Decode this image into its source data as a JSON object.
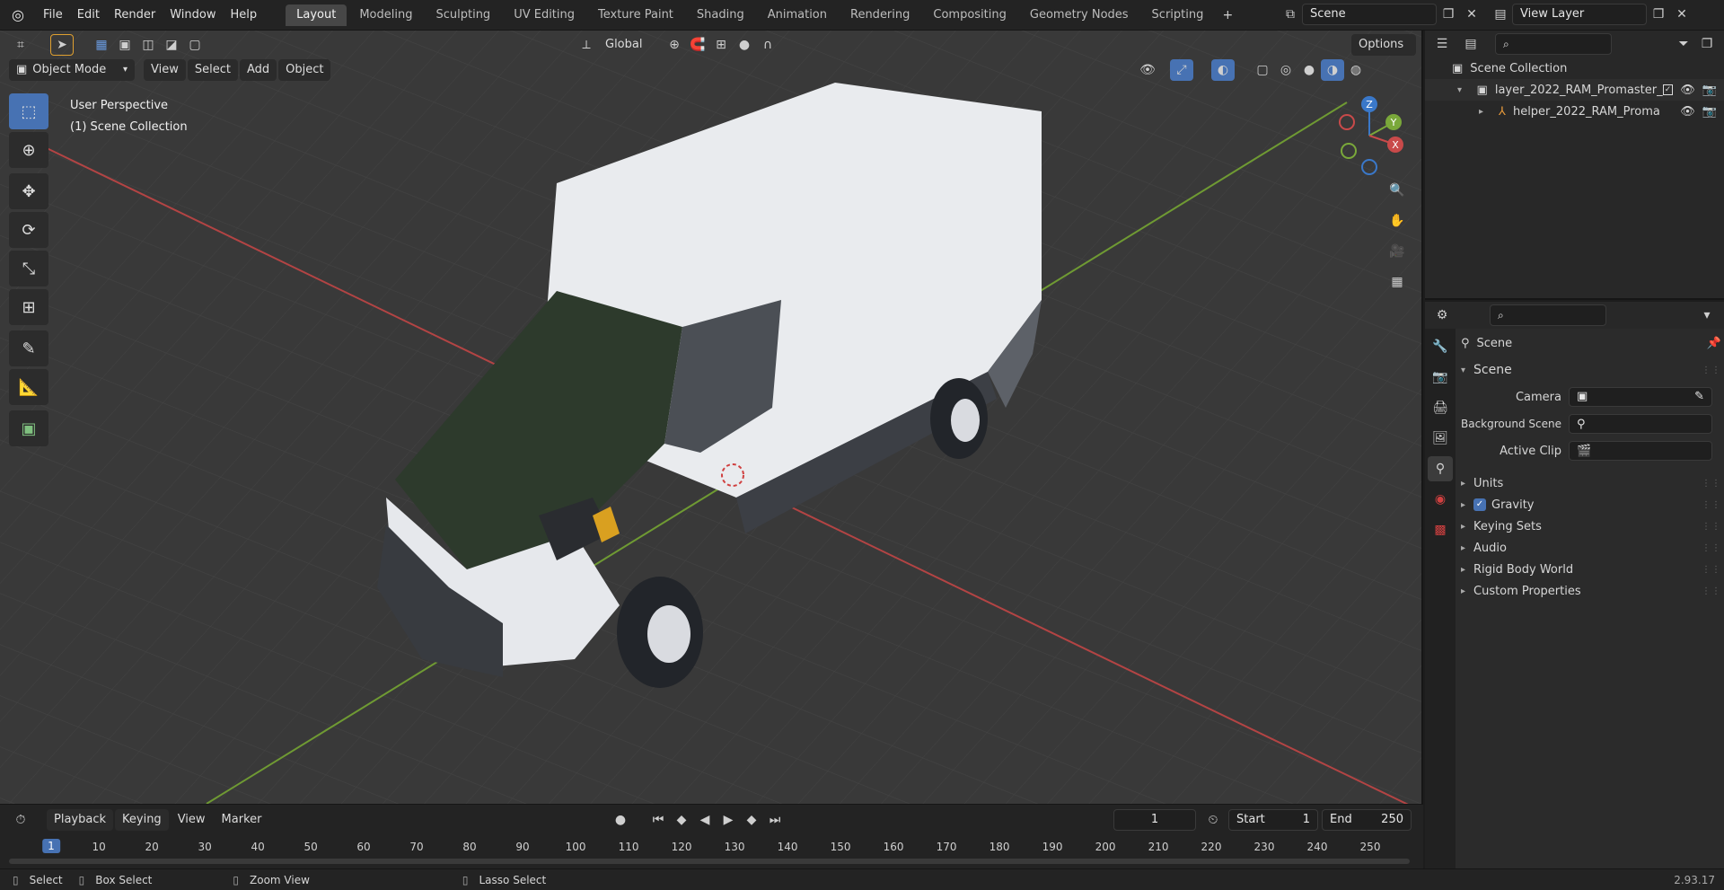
{
  "topbar": {
    "menus": [
      "File",
      "Edit",
      "Render",
      "Window",
      "Help"
    ],
    "workspaces": [
      "Layout",
      "Modeling",
      "Sculpting",
      "UV Editing",
      "Texture Paint",
      "Shading",
      "Animation",
      "Rendering",
      "Compositing",
      "Geometry Nodes",
      "Scripting"
    ],
    "active_workspace": "Layout",
    "scene_name": "Scene",
    "view_layer": "View Layer"
  },
  "viewport": {
    "orientation": "Global",
    "options_label": "Options",
    "mode": "Object Mode",
    "menus": [
      "View",
      "Select",
      "Add",
      "Object"
    ],
    "overlay_line1": "User Perspective",
    "overlay_line2": "(1) Scene Collection",
    "gizmo": {
      "x": "X",
      "y": "Y",
      "z": "Z"
    }
  },
  "timeline": {
    "menus": [
      "Playback",
      "Keying",
      "View",
      "Marker"
    ],
    "current_frame": "1",
    "start_label": "Start",
    "start_value": "1",
    "end_label": "End",
    "end_value": "250",
    "ticks": [
      "1",
      "10",
      "20",
      "30",
      "40",
      "50",
      "60",
      "70",
      "80",
      "90",
      "100",
      "110",
      "120",
      "130",
      "140",
      "150",
      "160",
      "170",
      "180",
      "190",
      "200",
      "210",
      "220",
      "230",
      "240",
      "250"
    ]
  },
  "statusbar": {
    "select": "Select",
    "box_select": "Box Select",
    "zoom_view": "Zoom View",
    "lasso_select": "Lasso Select",
    "version": "2.93.17"
  },
  "outliner": {
    "root": "Scene Collection",
    "items": [
      {
        "label": "layer_2022_RAM_Promaster_"
      },
      {
        "label": "helper_2022_RAM_Proma"
      }
    ]
  },
  "properties": {
    "context": "Scene",
    "panel_title": "Scene",
    "camera_label": "Camera",
    "background_label": "Background Scene",
    "clip_label": "Active Clip",
    "subpanels": [
      "Units",
      "Gravity",
      "Keying Sets",
      "Audio",
      "Rigid Body World",
      "Custom Properties"
    ]
  },
  "colors": {
    "accent": "#4772b3",
    "x_axis": "#c94a4a",
    "y_axis": "#7aa83a",
    "z_axis": "#3a78c9"
  }
}
